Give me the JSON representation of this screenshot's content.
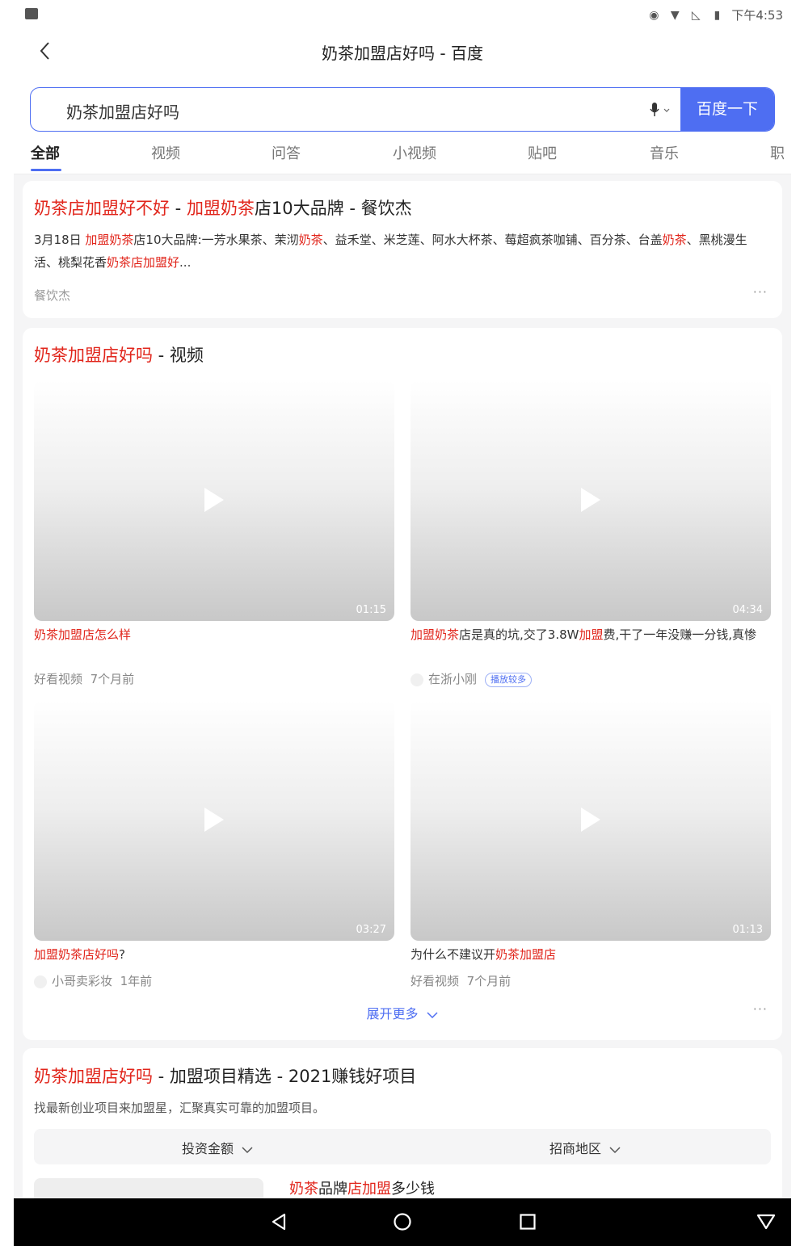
{
  "status_bar": {
    "time": "下午4:53"
  },
  "header": {
    "title": "奶茶加盟店好吗 - 百度"
  },
  "search": {
    "query": "奶茶加盟店好吗",
    "button_label": "百度一下"
  },
  "tabs": [
    {
      "label": "全部",
      "active": true
    },
    {
      "label": "视频"
    },
    {
      "label": "问答"
    },
    {
      "label": "小视频"
    },
    {
      "label": "贴吧"
    },
    {
      "label": "音乐"
    },
    {
      "label": "职"
    }
  ],
  "result1": {
    "title_parts": [
      "奶茶店加盟好不好",
      " - ",
      "加盟奶茶",
      "店10大品牌 - 餐饮杰"
    ],
    "snippet_parts": [
      "3月18日 ",
      "加盟奶茶",
      "店10大品牌:一芳水果茶、茉沏",
      "奶茶",
      "、益禾堂、米芝莲、阿水大杯茶、莓超疯茶咖铺、百分茶、台盖",
      "奶茶",
      "、黑桃漫生活、桃梨花香",
      "奶茶店加盟好",
      "..."
    ],
    "source": "餐饮杰",
    "more": "···"
  },
  "video_card": {
    "title_parts": [
      "奶茶加盟店好吗",
      " - 视频"
    ],
    "videos": [
      {
        "duration": "01:15",
        "title_parts": [
          "奶茶加盟店怎么样"
        ],
        "source": "好看视频",
        "time": "7个月前"
      },
      {
        "duration": "04:34",
        "title_parts": [
          "加盟奶茶",
          "店是真的坑,交了3.8W",
          "加盟",
          "费,干了一年没赚一分钱,真惨"
        ],
        "author": "在浙小刚",
        "badge": "播放较多"
      },
      {
        "duration": "03:27",
        "title_parts": [
          "加盟奶茶店好吗",
          "?"
        ],
        "author": "小哥卖彩妆",
        "time": "1年前"
      },
      {
        "duration": "01:13",
        "title_parts": [
          "为什么不建议开",
          "奶茶加盟店"
        ],
        "source": "好看视频",
        "time": "7个月前"
      }
    ],
    "expand_label": "展开更多",
    "more": "···"
  },
  "result3": {
    "title_parts": [
      "奶茶加盟店好吗",
      " - 加盟项目精选 - 2021赚钱好项目"
    ],
    "desc": "找最新创业项目来加盟星，汇聚真实可靠的加盟项目。",
    "filters": [
      "投资金额",
      "招商地区"
    ],
    "item_title_parts": [
      "奶茶",
      "品牌",
      "店加盟",
      "多少钱"
    ]
  }
}
